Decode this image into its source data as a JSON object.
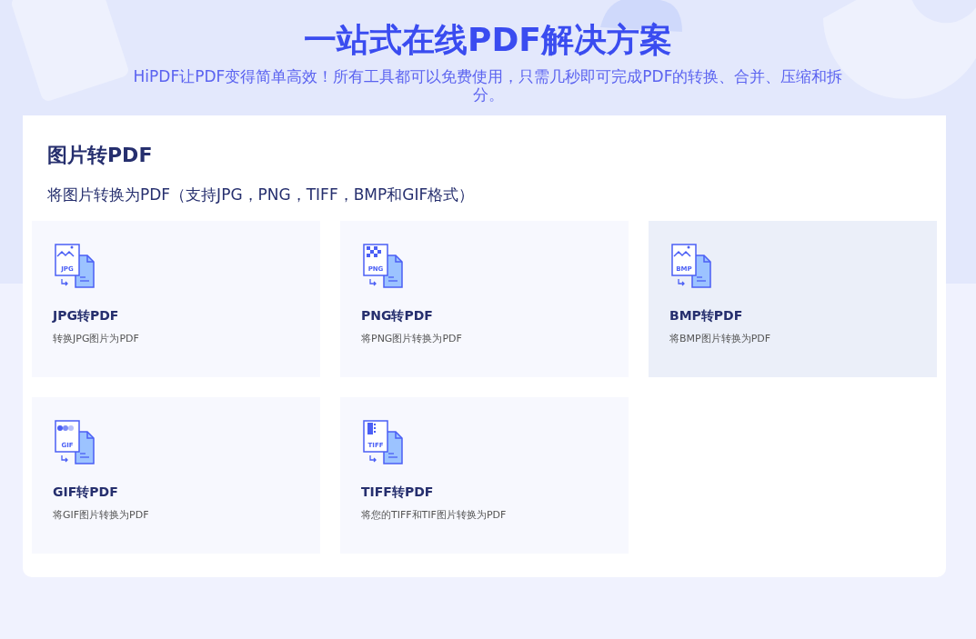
{
  "hero": {
    "title": "一站式在线PDF解决方案",
    "subtitle": "HiPDF让PDF变得简单高效！所有工具都可以免费使用，只需几秒即可完成PDF的转换、合并、压缩和拆分。"
  },
  "section": {
    "title": "图片转PDF",
    "description": "将图片转换为PDF（支持JPG，PNG，TIFF，BMP和GIF格式）",
    "tools": [
      {
        "kind": "landscape",
        "badge": "JPG",
        "title": "JPG转PDF",
        "description": "转换JPG图片为PDF",
        "selected": false
      },
      {
        "kind": "checker",
        "badge": "PNG",
        "title": "PNG转PDF",
        "description": "将PNG图片转换为PDF",
        "selected": false
      },
      {
        "kind": "landscape",
        "badge": "BMP",
        "title": "BMP转PDF",
        "description": "将BMP图片转换为PDF",
        "selected": true
      },
      {
        "kind": "dots",
        "badge": "GIF",
        "title": "GIF转PDF",
        "description": "将GIF图片转换为PDF",
        "selected": false
      },
      {
        "kind": "bars",
        "badge": "TIFF",
        "title": "TIFF转PDF",
        "description": "将您的TIFF和TIF图片转换为PDF",
        "selected": false
      }
    ]
  }
}
